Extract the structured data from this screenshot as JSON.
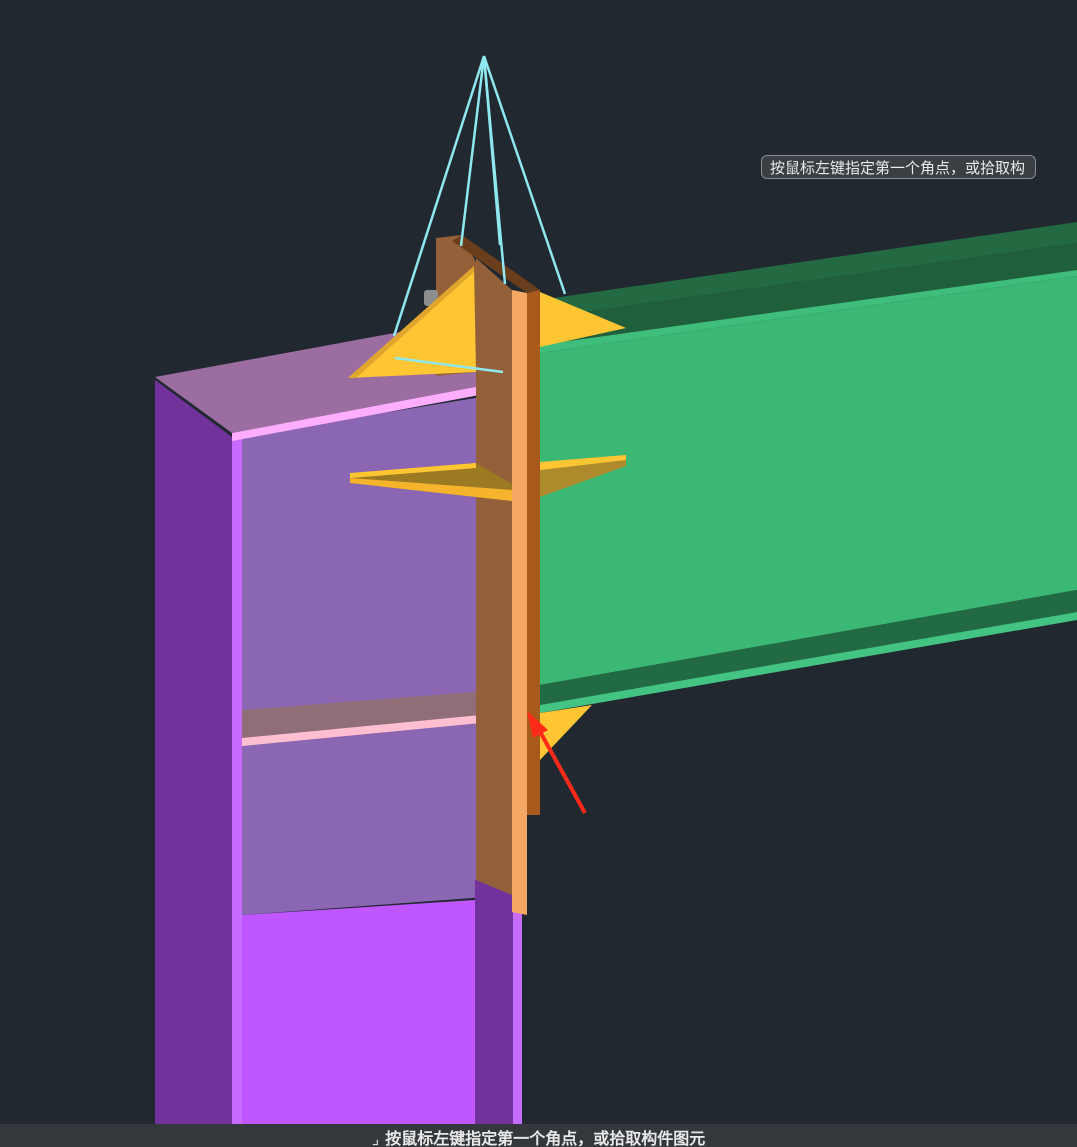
{
  "viewport": {
    "background": "#212830"
  },
  "tooltip": {
    "text": "按鼠标左键指定第一个角点，或拾取构"
  },
  "command_bar": {
    "icon": "cursor-corner-icon",
    "icon_glyph": "⌟",
    "prompt": "按鼠标左键指定第一个角点，或拾取构件图元"
  },
  "colors": {
    "column": "#bf56ff",
    "beam": "#3ab874",
    "end_plate": "#93603a",
    "stiffener": "#ffc634",
    "lift_line": "#8fe8f0",
    "arrow": "#ff2a1a"
  }
}
